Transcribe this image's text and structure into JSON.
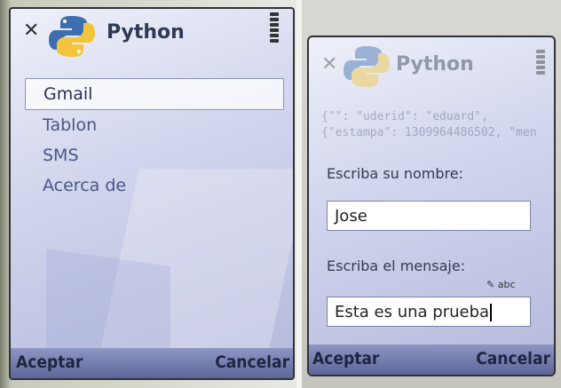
{
  "left_screen": {
    "app_title": "Python",
    "menu": [
      {
        "label": "Gmail",
        "selected": true
      },
      {
        "label": "Tablon",
        "selected": false
      },
      {
        "label": "SMS",
        "selected": false
      },
      {
        "label": "Acerca de",
        "selected": false
      }
    ],
    "softkeys": {
      "left": "Aceptar",
      "right": "Cancelar"
    }
  },
  "right_screen": {
    "app_title": "Python",
    "background_text": [
      "{\"\": \"uderid\": \"eduard\",",
      "{\"estampa\": 1309964486502, \"men"
    ],
    "name_label": "Escriba su nombre:",
    "name_value": "Jose",
    "message_label": "Escriba el mensaje:",
    "input_mode": "abc",
    "message_value": "Esta es una prueba",
    "softkeys": {
      "left": "Aceptar",
      "right": "Cancelar"
    }
  },
  "colors": {
    "accent": "#5d6699",
    "title": "#2f3a55",
    "menu_text": "#4a5683"
  }
}
